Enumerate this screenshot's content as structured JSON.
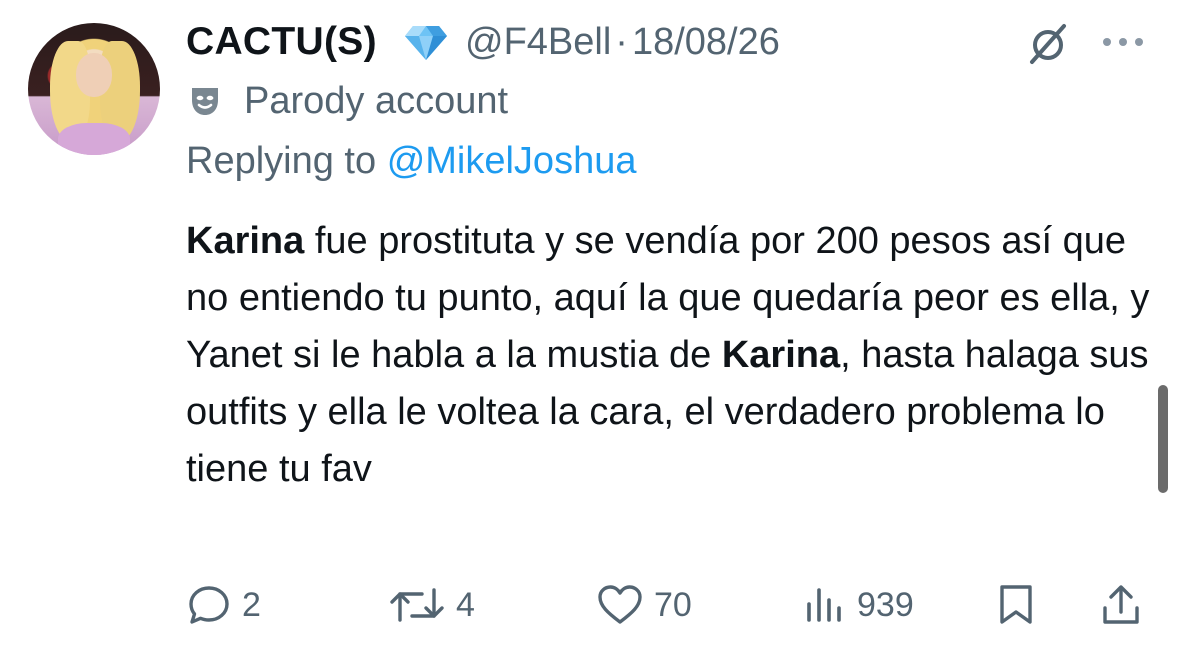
{
  "tweet": {
    "display_name": "CACTU(S)",
    "badge_icon": "diamond-icon",
    "handle": "@F4Bell",
    "separator": "·",
    "date": "18/08/26",
    "label_icon": "theater-mask-icon",
    "account_label": "Parody account",
    "replying_prefix": "Replying to",
    "replying_to": "@MikelJoshua",
    "body": {
      "p1": "Karina",
      "p2": " fue prostituta y se vendía por 200 pesos así que no entiendo tu punto, aquí la que quedaría peor es ella, y Yanet si le habla a la mustia de ",
      "p3": "Karina",
      "p4": ", hasta halaga sus outfits y ella le voltea la cara, el verdadero problema lo tiene tu fav"
    }
  },
  "actions": {
    "replies": "2",
    "retweets": "4",
    "likes": "70",
    "views": "939"
  },
  "colors": {
    "text": "#0f1419",
    "secondary": "#536471",
    "link": "#1d9bf0",
    "diamond": "#4aa8e8"
  }
}
